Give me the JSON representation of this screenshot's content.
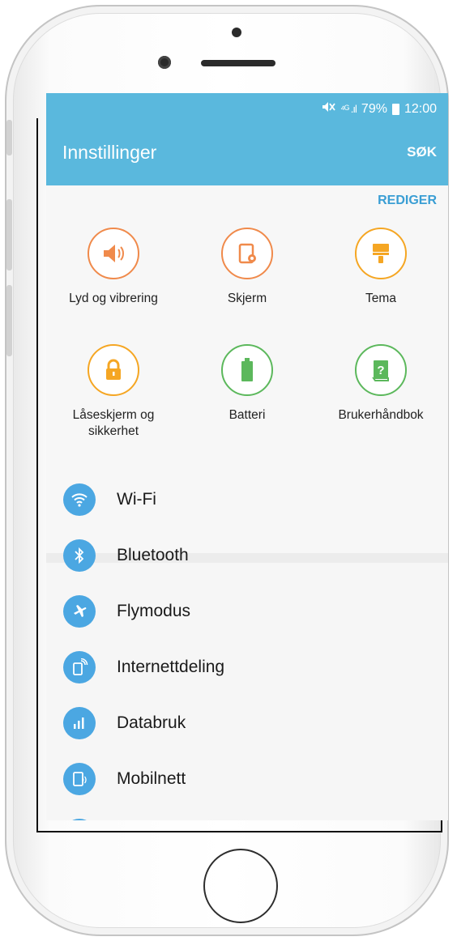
{
  "status_bar": {
    "signal": "⁴ᴳ .ıl",
    "battery": "79%",
    "time": "12:00"
  },
  "header": {
    "title": "Innstillinger",
    "search": "SØK"
  },
  "quick_settings": {
    "edit": "REDIGER",
    "tiles": [
      {
        "label": "Lyd og vibrering",
        "icon": "volume-icon",
        "color": "#f08a4b"
      },
      {
        "label": "Skjerm",
        "icon": "display-icon",
        "color": "#f08a4b"
      },
      {
        "label": "Tema",
        "icon": "paint-brush-icon",
        "color": "#f5a623"
      },
      {
        "label": "Låseskjerm og sikkerhet",
        "icon": "lock-icon",
        "color": "#f5a623"
      },
      {
        "label": "Batteri",
        "icon": "battery-icon",
        "color": "#5cb85c"
      },
      {
        "label": "Brukerhåndbok",
        "icon": "manual-icon",
        "color": "#5cb85c"
      }
    ]
  },
  "settings_list": [
    {
      "label": "Wi-Fi",
      "icon": "wifi-icon"
    },
    {
      "label": "Bluetooth",
      "icon": "bluetooth-icon"
    },
    {
      "label": "Flymodus",
      "icon": "airplane-icon"
    },
    {
      "label": "Internettdeling",
      "icon": "hotspot-icon"
    },
    {
      "label": "Databruk",
      "icon": "data-usage-icon"
    },
    {
      "label": "Mobilnett",
      "icon": "mobile-network-icon"
    }
  ],
  "colors": {
    "accent": "#5ab8dd",
    "list_icon": "#4ba7e2",
    "edit": "#3a9ed4"
  }
}
